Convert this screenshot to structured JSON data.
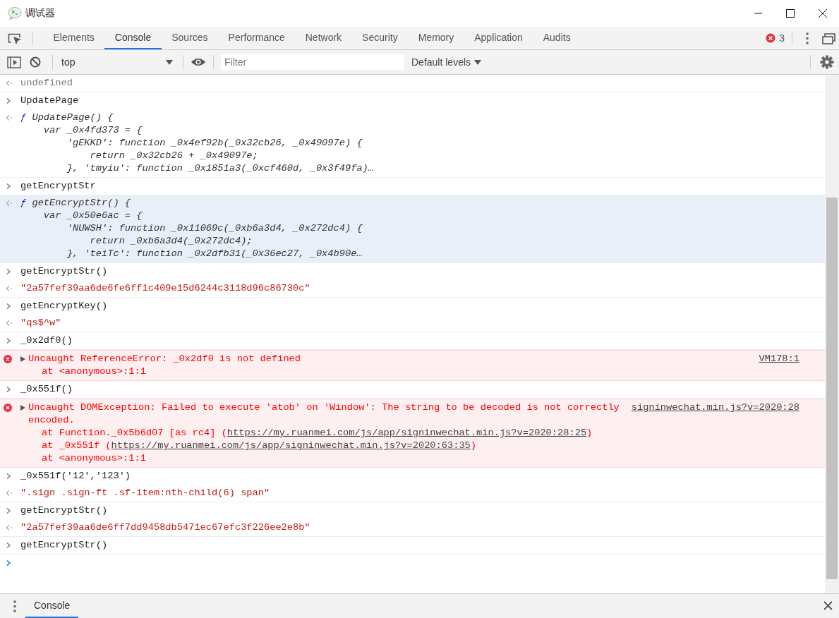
{
  "window": {
    "title": "调试器"
  },
  "tabs": [
    {
      "label": "Elements",
      "selected": false
    },
    {
      "label": "Console",
      "selected": true
    },
    {
      "label": "Sources",
      "selected": false
    },
    {
      "label": "Performance",
      "selected": false
    },
    {
      "label": "Network",
      "selected": false
    },
    {
      "label": "Security",
      "selected": false
    },
    {
      "label": "Memory",
      "selected": false
    },
    {
      "label": "Application",
      "selected": false
    },
    {
      "label": "Audits",
      "selected": false
    }
  ],
  "error_count": "3",
  "toolbar": {
    "context": "top",
    "filter": {
      "placeholder": "Filter"
    },
    "levels": "Default levels"
  },
  "console": [
    {
      "kind": "undefined",
      "text": "undefined"
    },
    {
      "kind": "input",
      "text": "UpdatePage"
    },
    {
      "kind": "function",
      "selected": false,
      "keyword": "ƒ",
      "lines": [
        "UpdatePage() {",
        "    var _0x4fd373 = {",
        "        'gEKKD': function _0x4ef92b(_0x32cb26, _0x49097e) {",
        "            return _0x32cb26 + _0x49097e;",
        "        }, 'tmyiu': function _0x1851a3(_0xcf460d, _0x3f49fa)…"
      ]
    },
    {
      "kind": "input",
      "text": "getEncryptStr"
    },
    {
      "kind": "function",
      "selected": true,
      "keyword": "ƒ",
      "lines": [
        "getEncryptStr() {",
        "    var _0x50e6ac = {",
        "        'NUWSH': function _0x11069c(_0xb6a3d4, _0x272dc4) {",
        "            return _0xb6a3d4(_0x272dc4);",
        "        }, 'teiTc': function _0x2dfb31(_0x36ec27, _0x4b90e…"
      ]
    },
    {
      "kind": "input",
      "text": "getEncryptStr()"
    },
    {
      "kind": "string",
      "text": "\"2a57fef39aa6de6fe6ff1c409e15d6244c3118d96c86730c\""
    },
    {
      "kind": "input",
      "text": "getEncryptKey()"
    },
    {
      "kind": "string",
      "text": "\"qs$^w\""
    },
    {
      "kind": "input",
      "text": "_0x2df0()"
    },
    {
      "kind": "error",
      "expanded": false,
      "message": "Uncaught ReferenceError: _0x2df0 is not defined",
      "source": "VM178:1",
      "stack": [
        {
          "text": "at <anonymous>:1:1"
        }
      ]
    },
    {
      "kind": "input",
      "text": "_0x551f()"
    },
    {
      "kind": "error",
      "expanded": false,
      "message": "Uncaught DOMException: Failed to execute 'atob' on 'Window': The string to be decoded is not correctly encoded.",
      "source": "signinwechat.min.js?v=2020:28",
      "stack": [
        {
          "text": "at Function._0x5b6d07 [as rc4] (",
          "link": "https://my.ruanmei.com/js/app/signinwechat.min.js?v=2020:28:25",
          "after": ")"
        },
        {
          "text": "at _0x551f (",
          "link": "https://my.ruanmei.com/js/app/signinwechat.min.js?v=2020:63:35",
          "after": ")"
        },
        {
          "text": "at <anonymous>:1:1"
        }
      ]
    },
    {
      "kind": "input",
      "text": "_0x551f('12','123')"
    },
    {
      "kind": "string",
      "text": "\".sign .sign-ft .sf-item:nth-child(6) span\""
    },
    {
      "kind": "input",
      "text": "getEncryptStr()"
    },
    {
      "kind": "string",
      "text": "\"2a57fef39aa6de6ff7dd9458db5471ec67efc3f226ee2e8b\""
    },
    {
      "kind": "input",
      "text": "getEncryptStr()"
    }
  ],
  "drawer": {
    "tabs": [
      {
        "label": "Console",
        "selected": true
      }
    ]
  }
}
